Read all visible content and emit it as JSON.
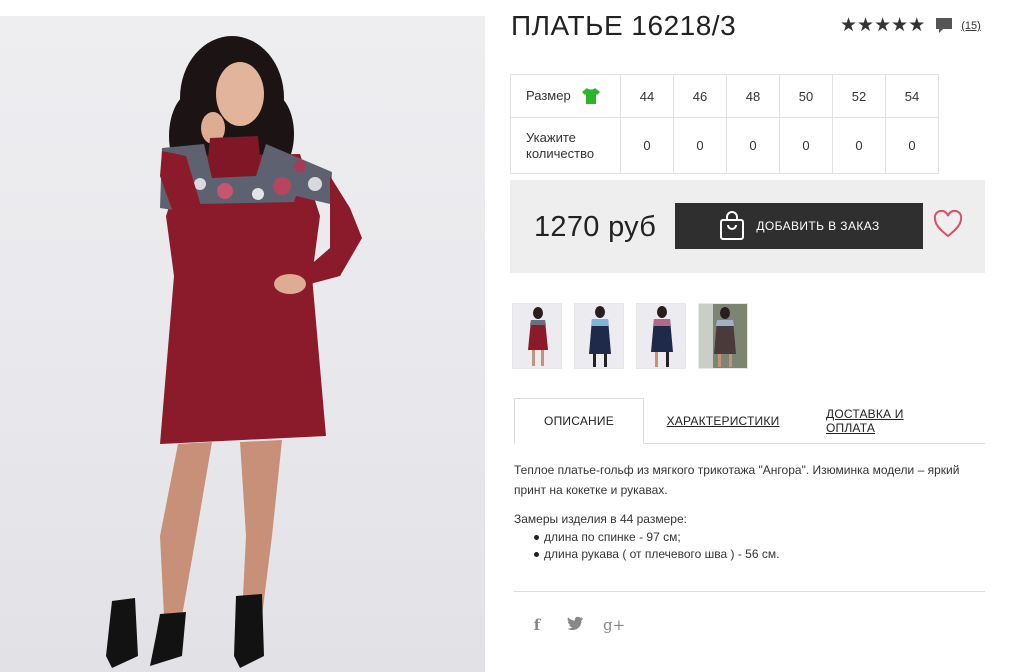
{
  "product": {
    "title": "ПЛАТЬЕ 16218/3",
    "rating_stars": 5,
    "star_glyph": "★",
    "review_count": "(15)",
    "price": "1270 руб",
    "add_to_cart_label": "ДОБАВИТЬ В ЗАКАЗ"
  },
  "size_table": {
    "size_label": "Размер",
    "quantity_label": "Укажите количество",
    "sizes": [
      "44",
      "46",
      "48",
      "50",
      "52",
      "54"
    ],
    "quantities": [
      "0",
      "0",
      "0",
      "0",
      "0",
      "0"
    ]
  },
  "tabs": [
    {
      "label": "ОПИСАНИЕ",
      "active": true
    },
    {
      "label": "ХАРАКТЕРИСТИКИ",
      "active": false
    },
    {
      "label": "ДОСТАВКА И ОПЛАТА",
      "active": false
    }
  ],
  "description": {
    "text": "Теплое платье-гольф из мягкого трикотажа \"Ангора\". Изюминка модели – яркий принт на кокетке и рукавах.",
    "measurements_title": "Замеры изделия в 44 размере:",
    "measurements": [
      "длина по спинке - 97 см;",
      "длина рукава ( от плечевого шва ) - 56 см."
    ]
  },
  "social": {
    "facebook": "f",
    "twitter": "t",
    "googleplus": "g+"
  },
  "colors": {
    "dress": "#8b1a2b",
    "button": "#2f2f2f",
    "heart": "#d9506a",
    "shirt_icon": "#2bb52b",
    "price_bg": "#eeeeee",
    "navy": "#1f2a4a"
  },
  "icons": {
    "shirt": "shirt-icon",
    "bag": "bag-icon",
    "heart": "heart-icon",
    "comment": "comment-icon"
  }
}
